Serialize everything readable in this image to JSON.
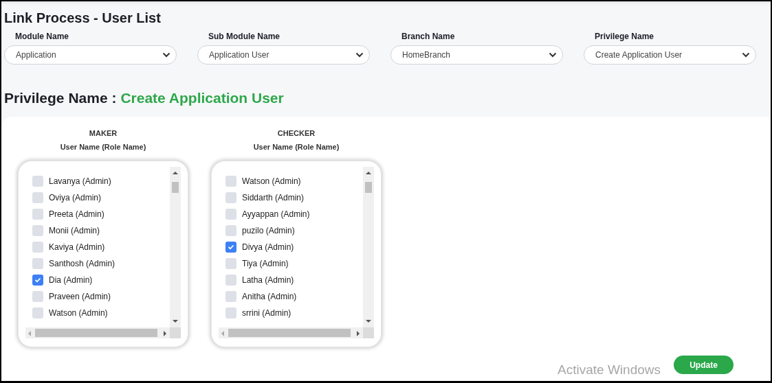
{
  "page": {
    "title": "Link Process - User List"
  },
  "filters": [
    {
      "label": "Module Name",
      "value": "Application"
    },
    {
      "label": "Sub Module Name",
      "value": "Application User"
    },
    {
      "label": "Branch Name",
      "value": "HomeBranch"
    },
    {
      "label": "Privilege Name",
      "value": "Create Application User"
    }
  ],
  "privilege_heading": {
    "label": "Privilege Name :",
    "value": "Create Application User"
  },
  "lists": [
    {
      "role": "MAKER",
      "column_heading": "User Name (Role Name)",
      "users": [
        {
          "name": "Lavanya (Admin)",
          "checked": false
        },
        {
          "name": "Oviya (Admin)",
          "checked": false
        },
        {
          "name": "Preeta (Admin)",
          "checked": false
        },
        {
          "name": "Monii (Admin)",
          "checked": false
        },
        {
          "name": "Kaviya (Admin)",
          "checked": false
        },
        {
          "name": "Santhosh (Admin)",
          "checked": false
        },
        {
          "name": "Dia (Admin)",
          "checked": true
        },
        {
          "name": "Praveen (Admin)",
          "checked": false
        },
        {
          "name": "Watson (Admin)",
          "checked": false
        }
      ]
    },
    {
      "role": "CHECKER",
      "column_heading": "User Name (Role Name)",
      "users": [
        {
          "name": "Watson (Admin)",
          "checked": false
        },
        {
          "name": "Siddarth (Admin)",
          "checked": false
        },
        {
          "name": "Ayyappan (Admin)",
          "checked": false
        },
        {
          "name": "puzilo (Admin)",
          "checked": false
        },
        {
          "name": "Divya (Admin)",
          "checked": true
        },
        {
          "name": "Tiya (Admin)",
          "checked": false
        },
        {
          "name": "Latha (Admin)",
          "checked": false
        },
        {
          "name": "Anitha (Admin)",
          "checked": false
        },
        {
          "name": "srrini (Admin)",
          "checked": false
        }
      ]
    }
  ],
  "update_button": {
    "label": "Update"
  },
  "os_notice": {
    "text": "Activate Windows"
  }
}
